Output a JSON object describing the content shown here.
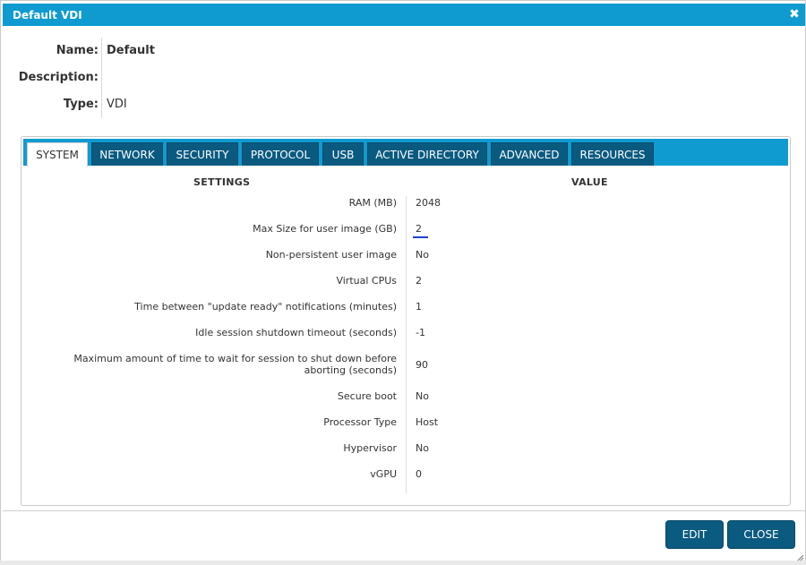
{
  "window": {
    "title": "Default VDI",
    "close_glyph": "✖"
  },
  "info": [
    {
      "label": "Name:",
      "value": "Default"
    },
    {
      "label": "Description:",
      "value": ""
    },
    {
      "label": "Type:",
      "value": "VDI"
    }
  ],
  "tabs": [
    {
      "label": "SYSTEM",
      "active": true
    },
    {
      "label": "NETWORK"
    },
    {
      "label": "SECURITY"
    },
    {
      "label": "PROTOCOL"
    },
    {
      "label": "USB"
    },
    {
      "label": "ACTIVE DIRECTORY"
    },
    {
      "label": "ADVANCED"
    },
    {
      "label": "RESOURCES"
    }
  ],
  "table": {
    "settings_header": "SETTINGS",
    "value_header": "VALUE",
    "rows": [
      {
        "setting": "RAM (MB)",
        "value": "2048"
      },
      {
        "setting": "Max Size for user image (GB)",
        "value": "2"
      },
      {
        "setting": "Non-persistent user image",
        "value": "No"
      },
      {
        "setting": "Virtual CPUs",
        "value": "2"
      },
      {
        "setting": "Time between \"update ready\" notifications (minutes)",
        "value": "1"
      },
      {
        "setting": "Idle session shutdown timeout (seconds)",
        "value": "-1"
      },
      {
        "setting": "Maximum amount of time to wait for session to shut down before aborting (seconds)",
        "value": "90"
      },
      {
        "setting": "Secure boot",
        "value": "No"
      },
      {
        "setting": "Processor Type",
        "value": "Host"
      },
      {
        "setting": "Hypervisor",
        "value": "No"
      },
      {
        "setting": "vGPU",
        "value": "0"
      }
    ]
  },
  "buttons": {
    "edit": "EDIT",
    "close": "CLOSE"
  },
  "colors": {
    "accent": "#0f9bd0",
    "tab_dark": "#0a5a80",
    "button": "#0b5a80"
  }
}
